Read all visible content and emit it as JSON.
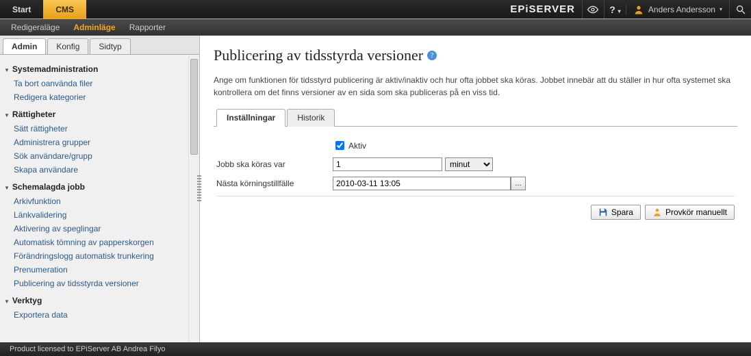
{
  "topbar": {
    "tabs": [
      {
        "label": "Start"
      },
      {
        "label": "CMS"
      }
    ],
    "brand": "EPiSERVER",
    "user": "Anders Andersson"
  },
  "subbar": {
    "items": [
      {
        "label": "Redigeraläge"
      },
      {
        "label": "Adminläge"
      },
      {
        "label": "Rapporter"
      }
    ]
  },
  "left": {
    "tabs": [
      {
        "label": "Admin"
      },
      {
        "label": "Konfig"
      },
      {
        "label": "Sidtyp"
      }
    ],
    "sections": [
      {
        "title": "Systemadministration",
        "items": [
          "Ta bort oanvända filer",
          "Redigera kategorier"
        ]
      },
      {
        "title": "Rättigheter",
        "items": [
          "Sätt rättigheter",
          "Administrera grupper",
          "Sök användare/grupp",
          "Skapa användare"
        ]
      },
      {
        "title": "Schemalagda jobb",
        "items": [
          "Arkivfunktion",
          "Länkvalidering",
          "Aktivering av speglingar",
          "Automatisk tömning av papperskorgen",
          "Förändringslogg automatisk trunkering",
          "Prenumeration",
          "Publicering av tidsstyrda versioner"
        ]
      },
      {
        "title": "Verktyg",
        "items": [
          "Exportera data"
        ]
      }
    ]
  },
  "main": {
    "title": "Publicering av tidsstyrda versioner",
    "description": "Ange om funktionen för tidsstyrd publicering är aktiv/inaktiv och hur ofta jobbet ska köras. Jobbet innebär att du ställer in hur ofta systemet ska kontrollera om det finns versioner av en sida som ska publiceras på en viss tid.",
    "tabs": [
      {
        "label": "Inställningar"
      },
      {
        "label": "Historik"
      }
    ],
    "form": {
      "active_label": "Aktiv",
      "active_checked": true,
      "interval_label": "Jobb ska köras var",
      "interval_value": "1",
      "interval_unit": "minut",
      "next_run_label": "Nästa körningstillfälle",
      "next_run_value": "2010-03-11 13:05"
    },
    "actions": {
      "save": "Spara",
      "run": "Provkör manuellt"
    }
  },
  "footer": {
    "text": "Product licensed to EPiServer AB Andrea Filyo"
  }
}
